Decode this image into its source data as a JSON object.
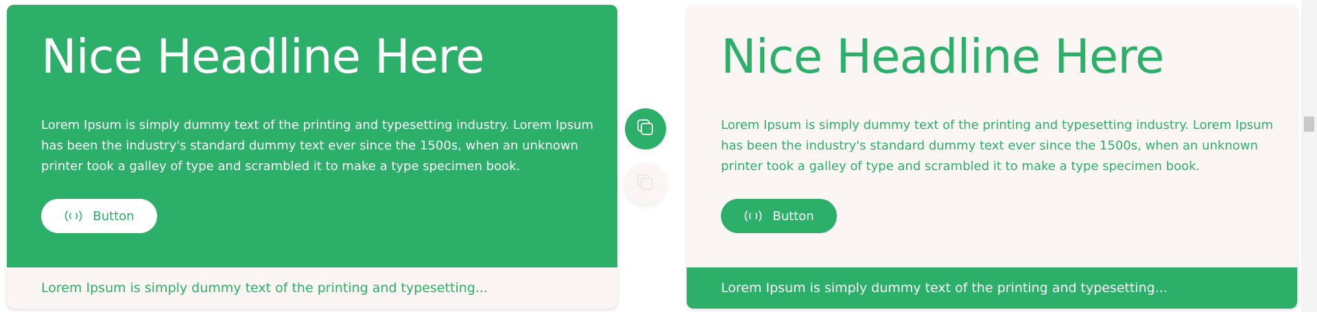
{
  "colors": {
    "brand_green": "#2caf69",
    "cream": "#fbf5f3",
    "white": "#ffffff"
  },
  "card_left": {
    "headline": "Nice Headline Here",
    "description": "Lorem Ipsum is simply dummy text of the printing and typesetting industry. Lorem Ipsum has been the industry's standard dummy text ever since the 1500s, when an unknown printer took a galley of type and scrambled it to make a type specimen book.",
    "button_label": "Button",
    "button_icon": "broadcast-icon",
    "footer_text": "Lorem Ipsum is simply dummy text of the printing and typesetting..."
  },
  "card_right": {
    "headline": "Nice Headline Here",
    "description": "Lorem Ipsum is simply dummy text of the printing and typesetting industry. Lorem Ipsum has been the industry's standard dummy text ever since the 1500s, when an unknown printer took a galley of type and scrambled it to make a type specimen book.",
    "button_label": "Button",
    "button_icon": "broadcast-icon",
    "footer_text": "Lorem Ipsum is simply dummy text of the printing and typesetting..."
  },
  "copy_buttons": [
    {
      "icon": "copy-icon",
      "state": "active"
    },
    {
      "icon": "copy-icon",
      "state": "inactive"
    }
  ]
}
